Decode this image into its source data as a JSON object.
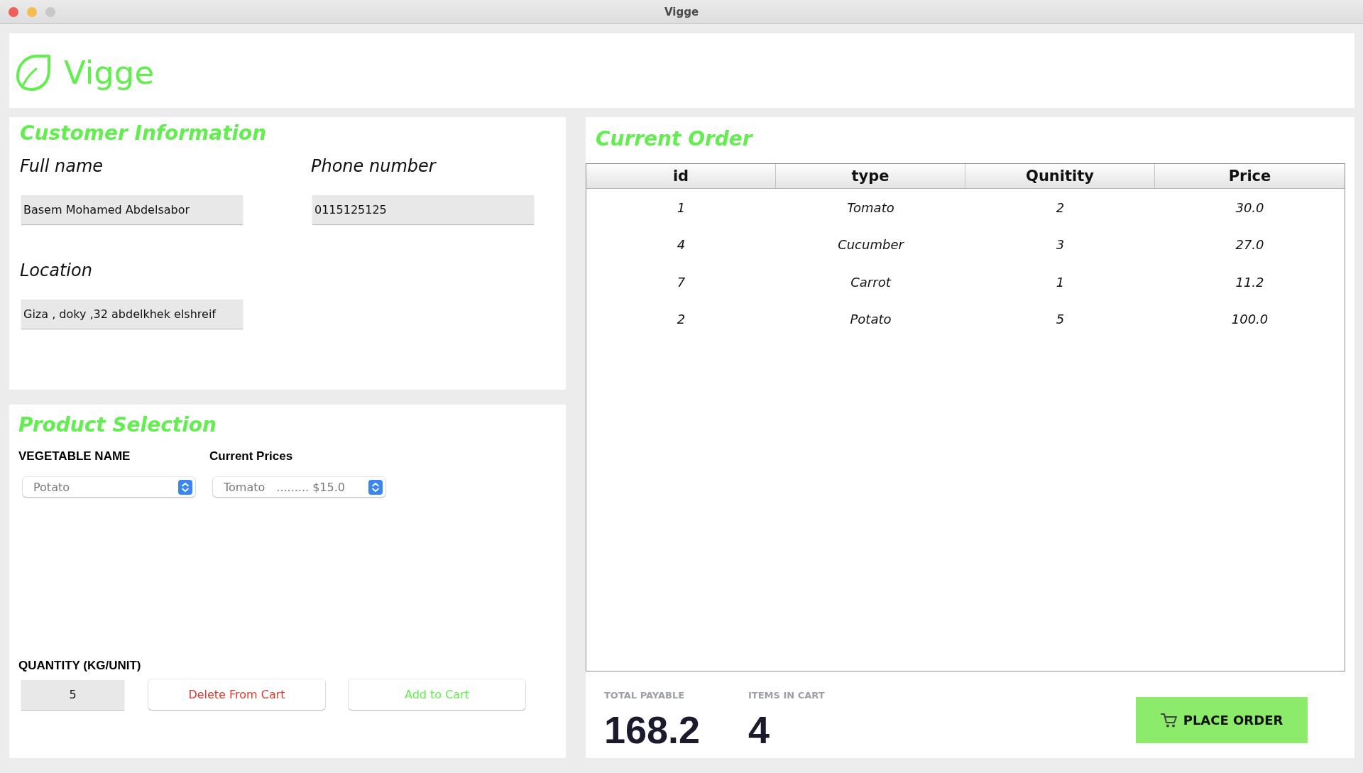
{
  "window": {
    "title": "Vigge"
  },
  "header": {
    "logo_text": "Vigge"
  },
  "customer_information": {
    "title": "Customer Information",
    "fields": [
      {
        "label": "Full name",
        "value": "Basem Mohamed Abdelsabor"
      },
      {
        "label": "Phone number",
        "value": "0115125125"
      },
      {
        "label": "Location",
        "value": "Giza , doky ,32 abdelkhek elshreif"
      }
    ]
  },
  "product_selection": {
    "title": "Product Selection",
    "dropdowns": [
      {
        "label": "VEGETABLE NAME",
        "value": "Potato"
      },
      {
        "label": "Current Prices",
        "value": "Tomato",
        "detail": "......... $15.0"
      }
    ],
    "quantity": {
      "label": "QUANTITY (KG/UNIT)",
      "value": "5"
    },
    "buttons": [
      {
        "label": "Delete From Cart",
        "kind": "danger"
      },
      {
        "label": "Add to Cart",
        "kind": "add"
      }
    ]
  },
  "current_order": {
    "title": "Current Order",
    "table": {
      "columns": [
        "id",
        "type",
        "Qunitity",
        "Price"
      ],
      "rows": [
        [
          "1",
          "Tomato",
          "2",
          "30.0"
        ],
        [
          "4",
          "Cucumber",
          "3",
          "27.0"
        ],
        [
          "7",
          "Carrot",
          "1",
          "11.2"
        ],
        [
          "2",
          "Potato",
          "5",
          "100.0"
        ]
      ]
    },
    "summary": [
      {
        "label": "TOTAL PAYABLE",
        "value": "168.2"
      },
      {
        "label": "ITEMS IN CART",
        "value": "4"
      }
    ],
    "place_order_button": {
      "label": "PLACE ORDER"
    }
  }
}
